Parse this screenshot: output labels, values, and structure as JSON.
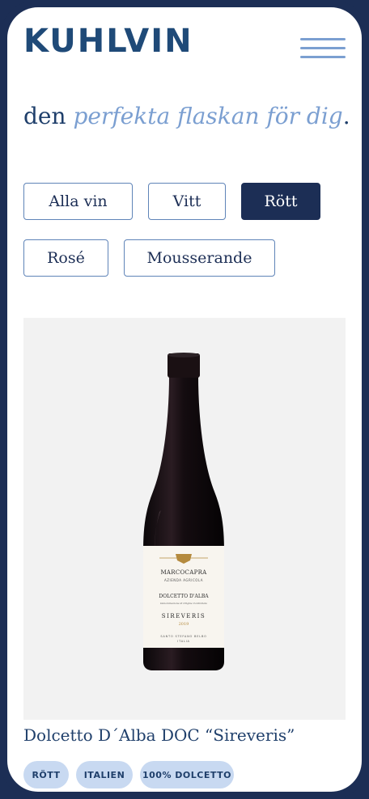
{
  "header": {
    "logo": "KUHLVIN",
    "menu_icon": "hamburger-menu-icon"
  },
  "headline": {
    "prefix": "den ",
    "accent": "perfekta flaskan för dig",
    "suffix": "."
  },
  "filters": [
    {
      "label": "Alla vin",
      "active": false
    },
    {
      "label": "Vitt",
      "active": false
    },
    {
      "label": "Rött",
      "active": true
    },
    {
      "label": "Rosé",
      "active": false
    },
    {
      "label": "Mousserande",
      "active": false
    }
  ],
  "product": {
    "title": "Dolcetto D´Alba DOC “Sireveris”",
    "label": {
      "brand": "MARCOCAPRA",
      "subbrand": "AZIENDA AGRICOLA",
      "wine": "DOLCETTO D'ALBA",
      "denomination": "Denominazione di Origine Controllata",
      "name": "SIREVERIS",
      "year": "2019",
      "footer1": "SANTO STEFANO BELBO",
      "footer2": "ITALIA"
    },
    "tags": [
      "RÖTT",
      "ITALIEN",
      "100% DOLCETTO"
    ]
  },
  "colors": {
    "frame": "#1c2e55",
    "brand": "#1f4a78",
    "accent": "#7b9fd1",
    "tag_bg": "#c8d9f1"
  }
}
